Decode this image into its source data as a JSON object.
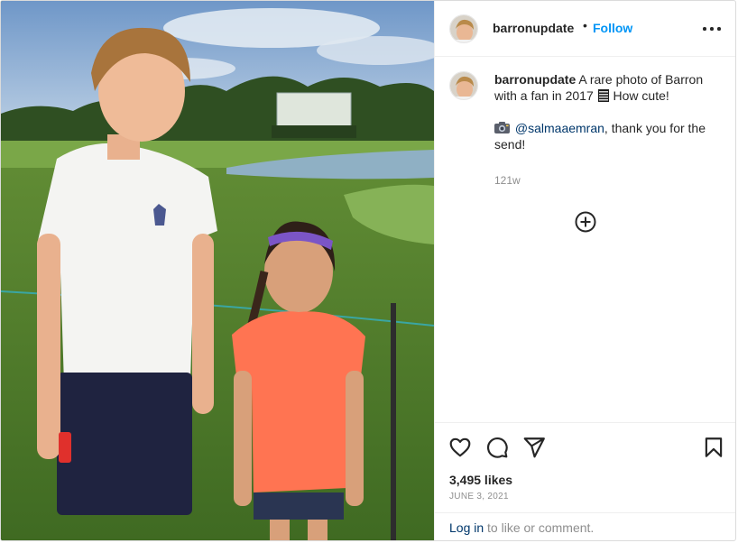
{
  "post": {
    "username": "barronupdate",
    "dot": "•",
    "follow_label": "Follow",
    "more_icon": "more-horizontal-icon",
    "caption_part1": "A rare photo of Barron with a fan in 2017",
    "caption_part2": "How cute!",
    "credit_mention": "@salmaaemran",
    "credit_rest": ", thank you for the send!",
    "time_ago": "121w",
    "likes": "3,495 likes",
    "date": "JUNE 3, 2021",
    "login_link": "Log in",
    "login_rest": " to like or comment."
  },
  "icons": [
    "heart-icon",
    "comment-icon",
    "share-icon",
    "bookmark-icon",
    "add-circle-icon",
    "camera-icon",
    "books-emoji-icon"
  ],
  "colors": {
    "link": "#0095f6",
    "mention": "#00376b",
    "muted": "#8e8e8e",
    "border": "#dbdbdb"
  }
}
